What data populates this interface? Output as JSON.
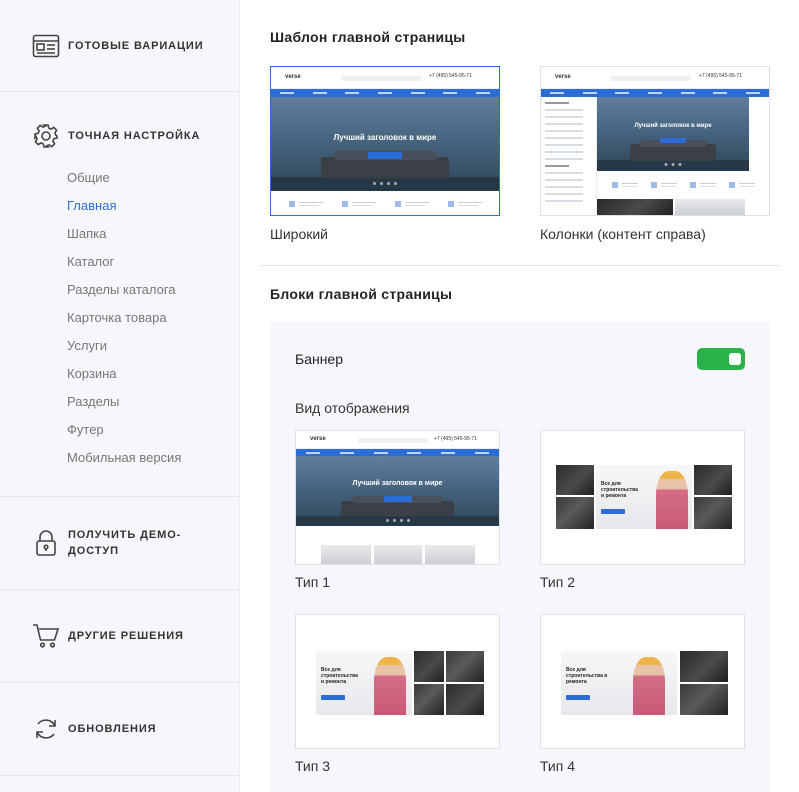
{
  "sidebar": {
    "variations_label": "Готовые вариации",
    "fine_label": "Точная настройка",
    "submenu": [
      "Общие",
      "Главная",
      "Шапка",
      "Каталог",
      "Разделы каталога",
      "Карточка товара",
      "Услуги",
      "Корзина",
      "Разделы",
      "Футер",
      "Мобильная версия"
    ],
    "active_item": "Главная",
    "demo_label": "Получить демо-доступ",
    "other_label": "Другие решения",
    "updates_label": "Обновления"
  },
  "main": {
    "template_section_title": "Шаблон главной страницы",
    "templates": [
      {
        "caption": "Широкий",
        "selected": true
      },
      {
        "caption": "Колонки (контент справа)",
        "selected": false
      }
    ],
    "blocks_section_title": "Блоки главной страницы",
    "banner": {
      "title": "Баннер",
      "enabled": true,
      "view_label": "Вид отображения",
      "types": [
        "Тип 1",
        "Тип 2",
        "Тип 3",
        "Тип 4"
      ]
    }
  },
  "preview": {
    "logo": "verse",
    "phone": "+7 (495) 545-95-71",
    "headline": "Лучший заголовок в мире",
    "promo_text": "Все для строительства и ремонта"
  },
  "colors": {
    "accent": "#2b6dd8",
    "toggle_on": "#2ab34a",
    "panel_bg": "#f6f7fb"
  },
  "icons": {
    "variations": "template-icon",
    "fine": "gear-icon",
    "demo": "lock-icon",
    "other": "cart-icon",
    "updates": "refresh-icon"
  }
}
